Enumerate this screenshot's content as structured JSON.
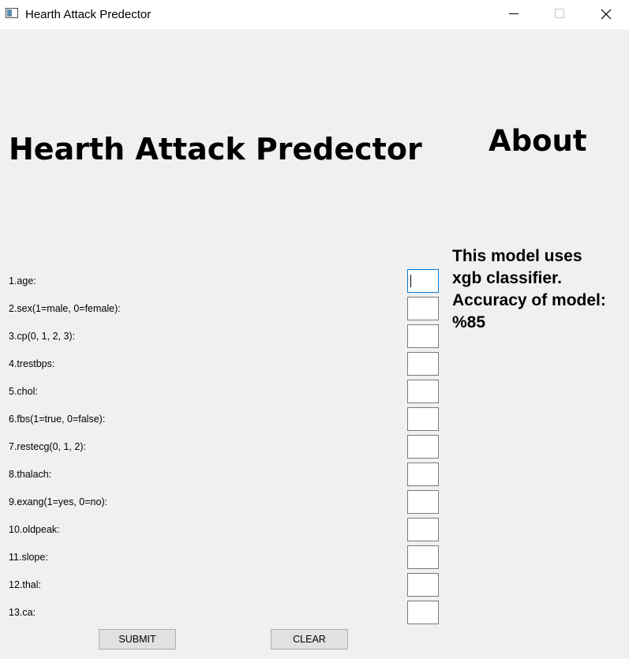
{
  "window": {
    "title": "Hearth Attack Predector"
  },
  "header": {
    "title": "Hearth Attack Predector",
    "about_title": "About"
  },
  "about": {
    "lines": [
      "This model uses",
      "xgb classifier.",
      "Accuracy of model:",
      "%85"
    ]
  },
  "form": {
    "fields": [
      {
        "label": "1.age:",
        "value": ""
      },
      {
        "label": "2.sex(1=male, 0=female):",
        "value": ""
      },
      {
        "label": "3.cp(0, 1, 2, 3):",
        "value": ""
      },
      {
        "label": "4.trestbps:",
        "value": ""
      },
      {
        "label": "5.chol:",
        "value": ""
      },
      {
        "label": "6.fbs(1=true, 0=false):",
        "value": ""
      },
      {
        "label": "7.restecg(0, 1, 2):",
        "value": ""
      },
      {
        "label": "8.thalach:",
        "value": ""
      },
      {
        "label": "9.exang(1=yes, 0=no):",
        "value": ""
      },
      {
        "label": "10.oldpeak:",
        "value": ""
      },
      {
        "label": "11.slope:",
        "value": ""
      },
      {
        "label": "12.thal:",
        "value": ""
      },
      {
        "label": "13.ca:",
        "value": ""
      }
    ],
    "submit_label": "SUBMIT",
    "clear_label": "CLEAR"
  }
}
